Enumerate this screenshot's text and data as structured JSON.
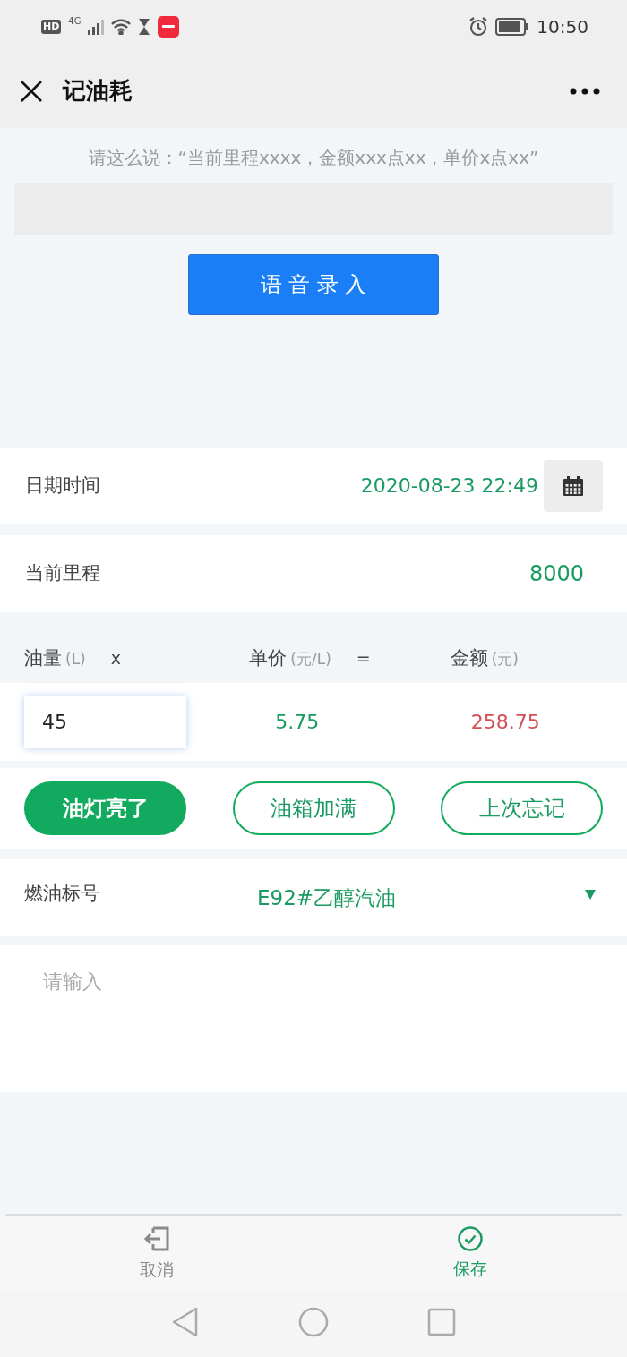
{
  "status_bar": {
    "hd": "HD",
    "network": "4G",
    "time": "10:50"
  },
  "header": {
    "title": "记油耗"
  },
  "voice": {
    "hint": "请这么说：“当前里程xxxx，金额xxx点xx，单价x点xx”",
    "button": "语 音 录 入"
  },
  "date_row": {
    "label": "日期时间",
    "value": "2020-08-23 22:49"
  },
  "mileage_row": {
    "label": "当前里程",
    "value": "8000"
  },
  "calc_header": [
    {
      "label": "油量",
      "unit": "(L)",
      "op": "x"
    },
    {
      "label": "单价",
      "unit": "(元/L)",
      "op": "="
    },
    {
      "label": "金额",
      "unit": "(元)"
    }
  ],
  "calc_values": {
    "volume": "45",
    "price": "5.75",
    "amount": "258.75"
  },
  "quick_buttons": [
    {
      "label": "油灯亮了",
      "selected": true
    },
    {
      "label": "油箱加满",
      "selected": false
    },
    {
      "label": "上次忘记",
      "selected": false
    }
  ],
  "fuel_row": {
    "label": "燃油标号",
    "value": "E92#乙醇汽油"
  },
  "notes": {
    "placeholder": "请输入"
  },
  "bottom_actions": [
    {
      "label": "取消",
      "kind": "cancel"
    },
    {
      "label": "保存",
      "kind": "save"
    }
  ]
}
